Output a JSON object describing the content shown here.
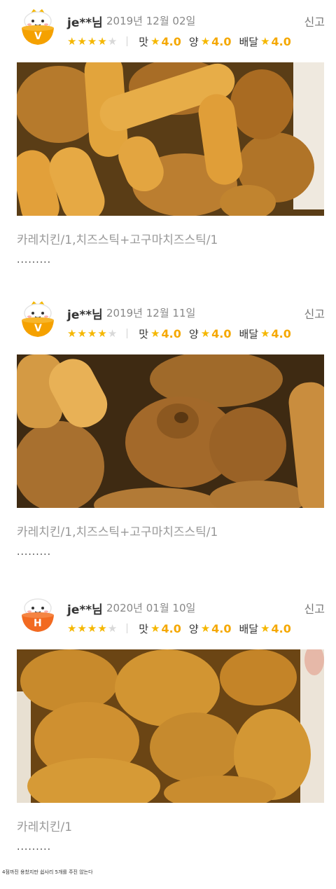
{
  "colors": {
    "star": "#f5b700",
    "score": "#f5a800",
    "vip_badge": "#f5a100",
    "heavy_badge": "#f26a21"
  },
  "reviews": [
    {
      "username": "je**",
      "suffix": "님",
      "date": "2019년 12월 02일",
      "report": "신고",
      "badge_letter": "V",
      "rating": 4,
      "subratings": [
        {
          "label": "맛",
          "value": "4.0"
        },
        {
          "label": "양",
          "value": "4.0"
        },
        {
          "label": "배달",
          "value": "4.0"
        }
      ],
      "photo_icon": "fried-chicken-and-cheese-sticks-photo",
      "menu": "카레치킨/1,치즈스틱+고구마치즈스틱/1",
      "text": "........."
    },
    {
      "username": "je**",
      "suffix": "님",
      "date": "2019년 12월 11일",
      "report": "신고",
      "badge_letter": "V",
      "rating": 4,
      "subratings": [
        {
          "label": "맛",
          "value": "4.0"
        },
        {
          "label": "양",
          "value": "4.0"
        },
        {
          "label": "배달",
          "value": "4.0"
        }
      ],
      "photo_icon": "fried-chicken-and-cheese-sticks-photo",
      "menu": "카레치킨/1,치즈스틱+고구마치즈스틱/1",
      "text": "........."
    },
    {
      "username": "je**",
      "suffix": "님",
      "date": "2020년 01월 10일",
      "report": "신고",
      "badge_letter": "H",
      "rating": 4,
      "subratings": [
        {
          "label": "맛",
          "value": "4.0"
        },
        {
          "label": "양",
          "value": "4.0"
        },
        {
          "label": "배달",
          "value": "4.0"
        }
      ],
      "photo_icon": "fried-chicken-photo",
      "menu": "카레치킨/1",
      "text": "........."
    }
  ],
  "footnote": "4점까진 용찼지만 쉽사리 5개를 주진 않는다"
}
